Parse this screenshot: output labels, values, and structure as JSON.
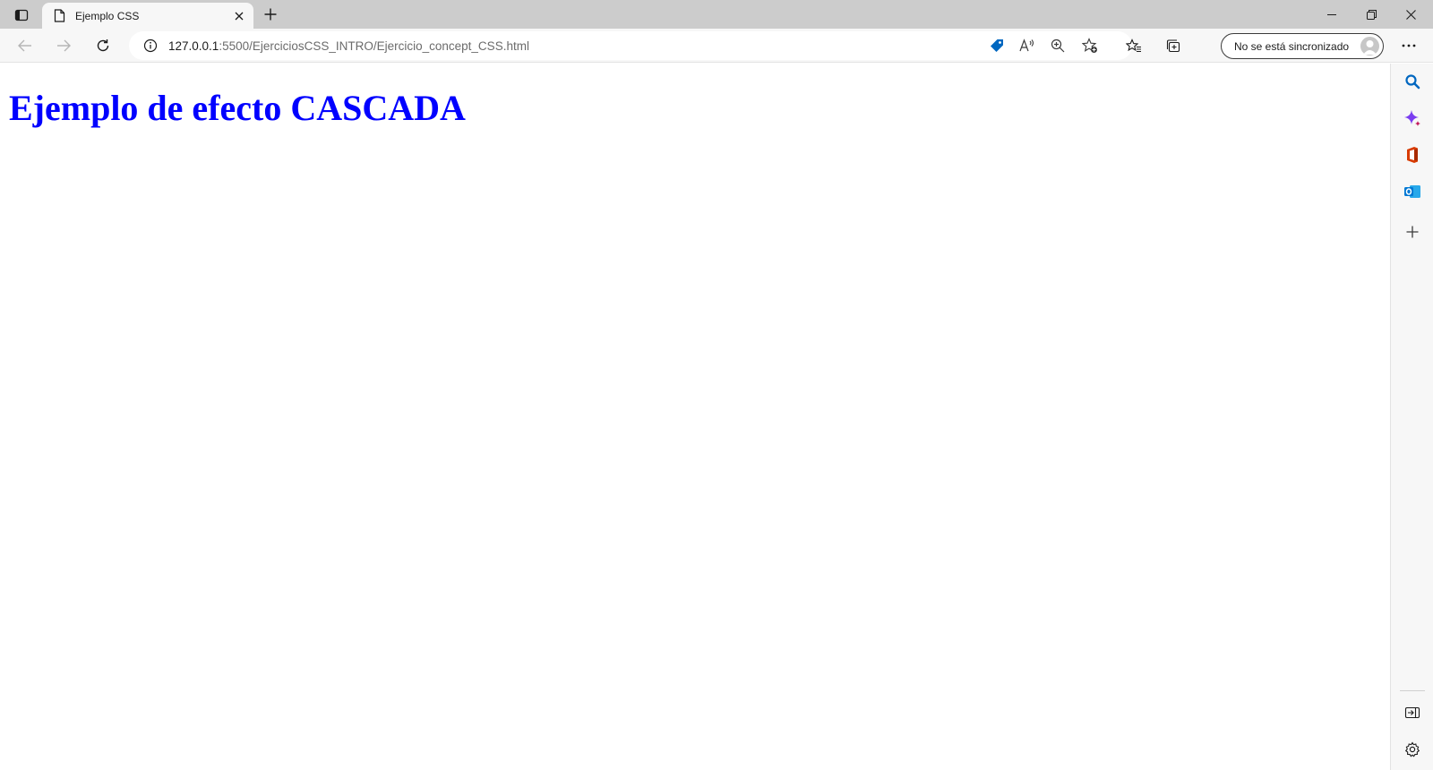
{
  "browser": {
    "tab": {
      "title": "Ejemplo CSS"
    },
    "address_bar": {
      "url_host": "127.0.0.1",
      "url_path": ":5500/EjerciciosCSS_INTRO/Ejercicio_concept_CSS.html"
    },
    "profile": {
      "sync_label": "No se está sincronizado"
    },
    "colors": {
      "accent": "#0067c0",
      "titlebar": "#cccccc",
      "toolbar": "#f7f7f7"
    }
  },
  "page": {
    "heading": "Ejemplo de efecto CASCADA",
    "heading_color": "#0000ff"
  },
  "sidebar": {
    "icons": [
      "search-icon",
      "copilot-icon",
      "office-icon",
      "outlook-icon",
      "add-icon",
      "hide-sidebar-icon",
      "settings-icon"
    ]
  }
}
